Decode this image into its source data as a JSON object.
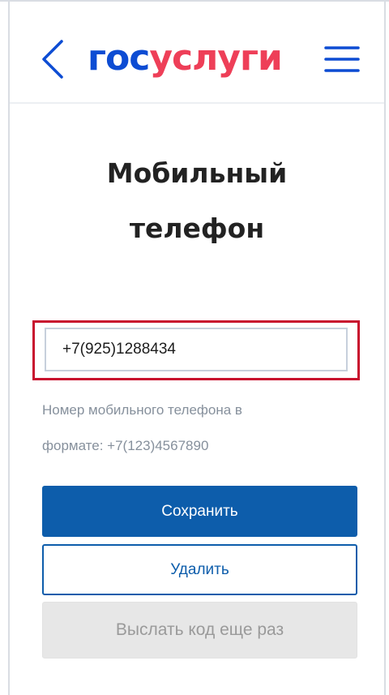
{
  "header": {
    "back_icon": "chevron-left-icon",
    "logo_part1": "гос",
    "logo_part2": "услуги",
    "menu_icon": "hamburger-menu-icon",
    "colors": {
      "logo_blue": "#0d4cd3",
      "logo_red": "#ee3f58"
    }
  },
  "main": {
    "title_line1": "Мобильный",
    "title_line2": "телефон",
    "phone": {
      "value": "+7(925)1288434",
      "focus_border_color": "#c8102e"
    },
    "hint_line1": "Номер мобильного телефона в",
    "hint_line2": "формате: +7(123)4567890",
    "buttons": {
      "save_label": "Сохранить",
      "delete_label": "Удалить",
      "resend_label": "Выслать код еще раз"
    },
    "colors": {
      "primary": "#0d5dab",
      "disabled_bg": "#e7e7e7",
      "disabled_text": "#9a9a9a"
    }
  }
}
